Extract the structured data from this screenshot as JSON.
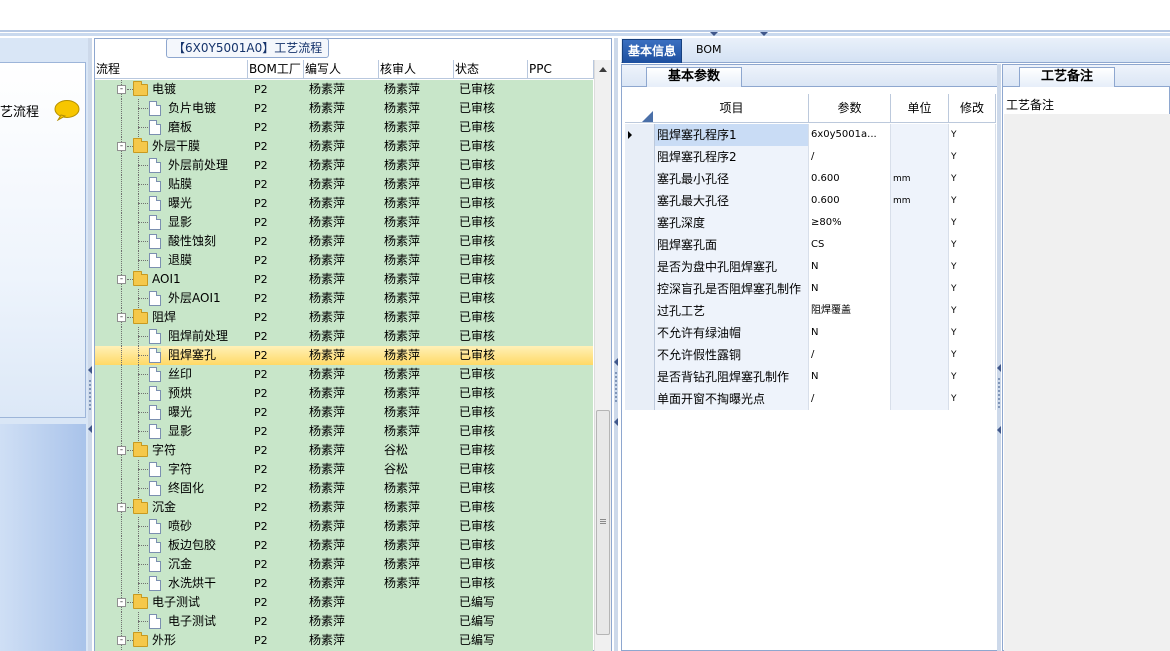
{
  "left_nav": {
    "label": "艺流程"
  },
  "tree_panel": {
    "title": "【6X0Y5001A0】工艺流程",
    "columns": [
      "流程",
      "BOM工厂",
      "编写人",
      "核审人",
      "状态",
      "PPC"
    ],
    "rows": [
      {
        "name": "电镀",
        "level": 0,
        "folder": true,
        "bom": "P2",
        "writer": "杨素萍",
        "reviewer": "杨素萍",
        "status": "已审核"
      },
      {
        "name": "负片电镀",
        "level": 1,
        "folder": false,
        "bom": "P2",
        "writer": "杨素萍",
        "reviewer": "杨素萍",
        "status": "已审核"
      },
      {
        "name": "磨板",
        "level": 1,
        "folder": false,
        "bom": "P2",
        "writer": "杨素萍",
        "reviewer": "杨素萍",
        "status": "已审核"
      },
      {
        "name": "外层干膜",
        "level": 0,
        "folder": true,
        "bom": "P2",
        "writer": "杨素萍",
        "reviewer": "杨素萍",
        "status": "已审核"
      },
      {
        "name": "外层前处理",
        "level": 1,
        "folder": false,
        "bom": "P2",
        "writer": "杨素萍",
        "reviewer": "杨素萍",
        "status": "已审核"
      },
      {
        "name": "贴膜",
        "level": 1,
        "folder": false,
        "bom": "P2",
        "writer": "杨素萍",
        "reviewer": "杨素萍",
        "status": "已审核"
      },
      {
        "name": "曝光",
        "level": 1,
        "folder": false,
        "bom": "P2",
        "writer": "杨素萍",
        "reviewer": "杨素萍",
        "status": "已审核"
      },
      {
        "name": "显影",
        "level": 1,
        "folder": false,
        "bom": "P2",
        "writer": "杨素萍",
        "reviewer": "杨素萍",
        "status": "已审核"
      },
      {
        "name": "酸性蚀刻",
        "level": 1,
        "folder": false,
        "bom": "P2",
        "writer": "杨素萍",
        "reviewer": "杨素萍",
        "status": "已审核"
      },
      {
        "name": "退膜",
        "level": 1,
        "folder": false,
        "bom": "P2",
        "writer": "杨素萍",
        "reviewer": "杨素萍",
        "status": "已审核"
      },
      {
        "name": "AOI1",
        "level": 0,
        "folder": true,
        "bom": "P2",
        "writer": "杨素萍",
        "reviewer": "杨素萍",
        "status": "已审核"
      },
      {
        "name": "外层AOI1",
        "level": 1,
        "folder": false,
        "bom": "P2",
        "writer": "杨素萍",
        "reviewer": "杨素萍",
        "status": "已审核"
      },
      {
        "name": "阻焊",
        "level": 0,
        "folder": true,
        "bom": "P2",
        "writer": "杨素萍",
        "reviewer": "杨素萍",
        "status": "已审核"
      },
      {
        "name": "阻焊前处理",
        "level": 1,
        "folder": false,
        "bom": "P2",
        "writer": "杨素萍",
        "reviewer": "杨素萍",
        "status": "已审核"
      },
      {
        "name": "阻焊塞孔",
        "level": 1,
        "folder": false,
        "bom": "P2",
        "writer": "杨素萍",
        "reviewer": "杨素萍",
        "status": "已审核",
        "selected": true
      },
      {
        "name": "丝印",
        "level": 1,
        "folder": false,
        "bom": "P2",
        "writer": "杨素萍",
        "reviewer": "杨素萍",
        "status": "已审核"
      },
      {
        "name": "预烘",
        "level": 1,
        "folder": false,
        "bom": "P2",
        "writer": "杨素萍",
        "reviewer": "杨素萍",
        "status": "已审核"
      },
      {
        "name": "曝光",
        "level": 1,
        "folder": false,
        "bom": "P2",
        "writer": "杨素萍",
        "reviewer": "杨素萍",
        "status": "已审核"
      },
      {
        "name": "显影",
        "level": 1,
        "folder": false,
        "bom": "P2",
        "writer": "杨素萍",
        "reviewer": "杨素萍",
        "status": "已审核"
      },
      {
        "name": "字符",
        "level": 0,
        "folder": true,
        "bom": "P2",
        "writer": "杨素萍",
        "reviewer": "谷松",
        "status": "已审核"
      },
      {
        "name": "字符",
        "level": 1,
        "folder": false,
        "bom": "P2",
        "writer": "杨素萍",
        "reviewer": "谷松",
        "status": "已审核"
      },
      {
        "name": "终固化",
        "level": 1,
        "folder": false,
        "bom": "P2",
        "writer": "杨素萍",
        "reviewer": "杨素萍",
        "status": "已审核"
      },
      {
        "name": "沉金",
        "level": 0,
        "folder": true,
        "bom": "P2",
        "writer": "杨素萍",
        "reviewer": "杨素萍",
        "status": "已审核"
      },
      {
        "name": "喷砂",
        "level": 1,
        "folder": false,
        "bom": "P2",
        "writer": "杨素萍",
        "reviewer": "杨素萍",
        "status": "已审核"
      },
      {
        "name": "板边包胶",
        "level": 1,
        "folder": false,
        "bom": "P2",
        "writer": "杨素萍",
        "reviewer": "杨素萍",
        "status": "已审核"
      },
      {
        "name": "沉金",
        "level": 1,
        "folder": false,
        "bom": "P2",
        "writer": "杨素萍",
        "reviewer": "杨素萍",
        "status": "已审核"
      },
      {
        "name": "水洗烘干",
        "level": 1,
        "folder": false,
        "bom": "P2",
        "writer": "杨素萍",
        "reviewer": "杨素萍",
        "status": "已审核"
      },
      {
        "name": "电子测试",
        "level": 0,
        "folder": true,
        "bom": "P2",
        "writer": "杨素萍",
        "reviewer": "",
        "status": "已编写"
      },
      {
        "name": "电子测试",
        "level": 1,
        "folder": false,
        "bom": "P2",
        "writer": "杨素萍",
        "reviewer": "",
        "status": "已编写"
      },
      {
        "name": "外形",
        "level": 0,
        "folder": true,
        "bom": "P2",
        "writer": "杨素萍",
        "reviewer": "",
        "status": "已编写"
      }
    ]
  },
  "right_panel": {
    "tabs": [
      "基本信息",
      "BOM"
    ],
    "params_tab": "基本参数",
    "remarks_tab": "工艺备注",
    "remarks_header": "工艺备注",
    "grid_columns": [
      "项目",
      "参数",
      "单位",
      "修改"
    ],
    "grid_rows": [
      {
        "item": "阻焊塞孔程序1",
        "param": "6x0y5001a...",
        "unit": "",
        "mod": "Y",
        "current": true
      },
      {
        "item": "阻焊塞孔程序2",
        "param": "/",
        "unit": "",
        "mod": "Y"
      },
      {
        "item": "塞孔最小孔径",
        "param": "0.600",
        "unit": "mm",
        "mod": "Y"
      },
      {
        "item": "塞孔最大孔径",
        "param": "0.600",
        "unit": "mm",
        "mod": "Y"
      },
      {
        "item": "塞孔深度",
        "param": "≥80%",
        "unit": "",
        "mod": "Y"
      },
      {
        "item": "阻焊塞孔面",
        "param": "CS",
        "unit": "",
        "mod": "Y"
      },
      {
        "item": "是否为盘中孔阻焊塞孔",
        "param": "N",
        "unit": "",
        "mod": "Y"
      },
      {
        "item": "控深盲孔是否阻焊塞孔制作",
        "param": "N",
        "unit": "",
        "mod": "Y"
      },
      {
        "item": "过孔工艺",
        "param": "阻焊覆盖",
        "unit": "",
        "mod": "Y"
      },
      {
        "item": "不允许有绿油帽",
        "param": "N",
        "unit": "",
        "mod": "Y"
      },
      {
        "item": "不允许假性露铜",
        "param": "/",
        "unit": "",
        "mod": "Y"
      },
      {
        "item": "是否背钻孔阻焊塞孔制作",
        "param": "N",
        "unit": "",
        "mod": "Y"
      },
      {
        "item": "单面开窗不掏曝光点",
        "param": "/",
        "unit": "",
        "mod": "Y"
      }
    ]
  },
  "colors": {
    "tree_bg": "#c8e6c9",
    "selected_row": "#ffd966",
    "active_tab": "#1d4f9f",
    "border": "#8ea7cf"
  }
}
